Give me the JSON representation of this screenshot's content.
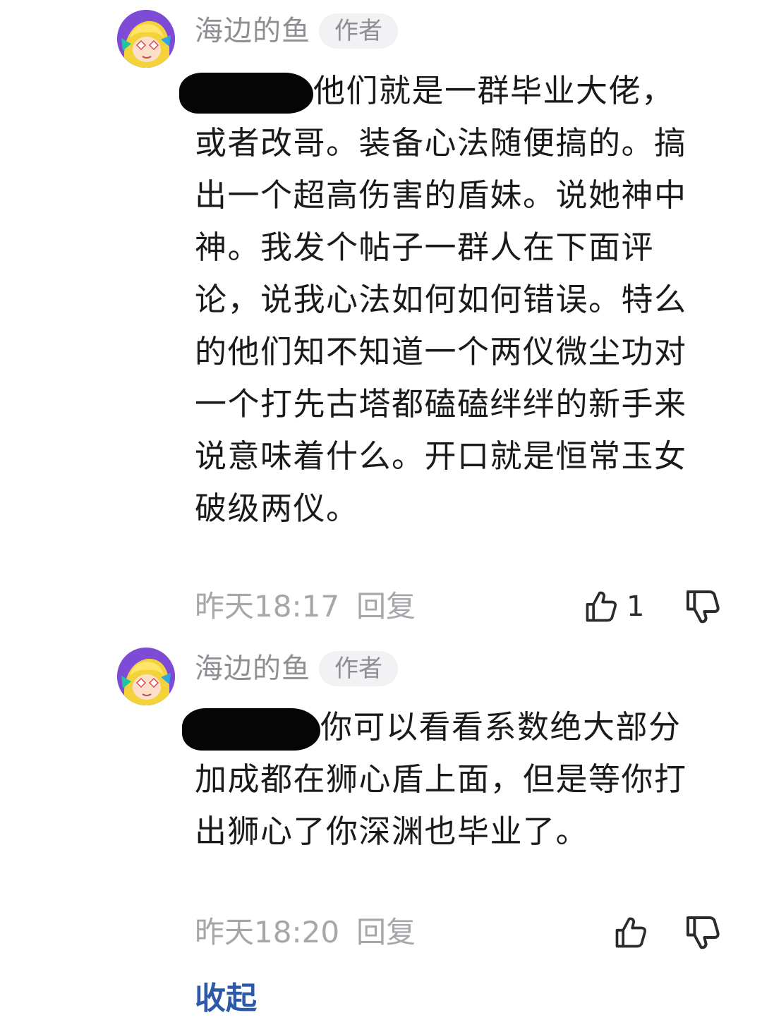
{
  "replies": [
    {
      "author": "海边的鱼",
      "badge": "作者",
      "text": "他们就是一群毕业大佬，或者改哥。装备心法随便搞的。搞出一个超高伤害的盾妹。说她神中神。我发个帖子一群人在下面评论，说我心法如何如何错误。特么的他们知不知道一个两仪微尘功对一个打先古塔都磕磕绊绊的新手来说意味着什么。开口就是恒常玉女破级两仪。",
      "time": "昨天18:17",
      "reply_label": "回复",
      "like_count": "1",
      "like_icon": "thumbs-up-icon",
      "dislike_icon": "thumbs-down-icon"
    },
    {
      "author": "海边的鱼",
      "badge": "作者",
      "text": "你可以看看系数绝大部分加成都在狮心盾上面，但是等你打出狮心了你深渊也毕业了。",
      "time": "昨天18:20",
      "reply_label": "回复",
      "like_count": "",
      "like_icon": "thumbs-up-icon",
      "dislike_icon": "thumbs-down-icon"
    }
  ],
  "collapse_label": "收起",
  "colors": {
    "meta_gray": "#a6a6ab",
    "link_blue": "#2c5aa8",
    "badge_bg": "#f2f2f4",
    "avatar_bg": "#7e4bd6"
  }
}
